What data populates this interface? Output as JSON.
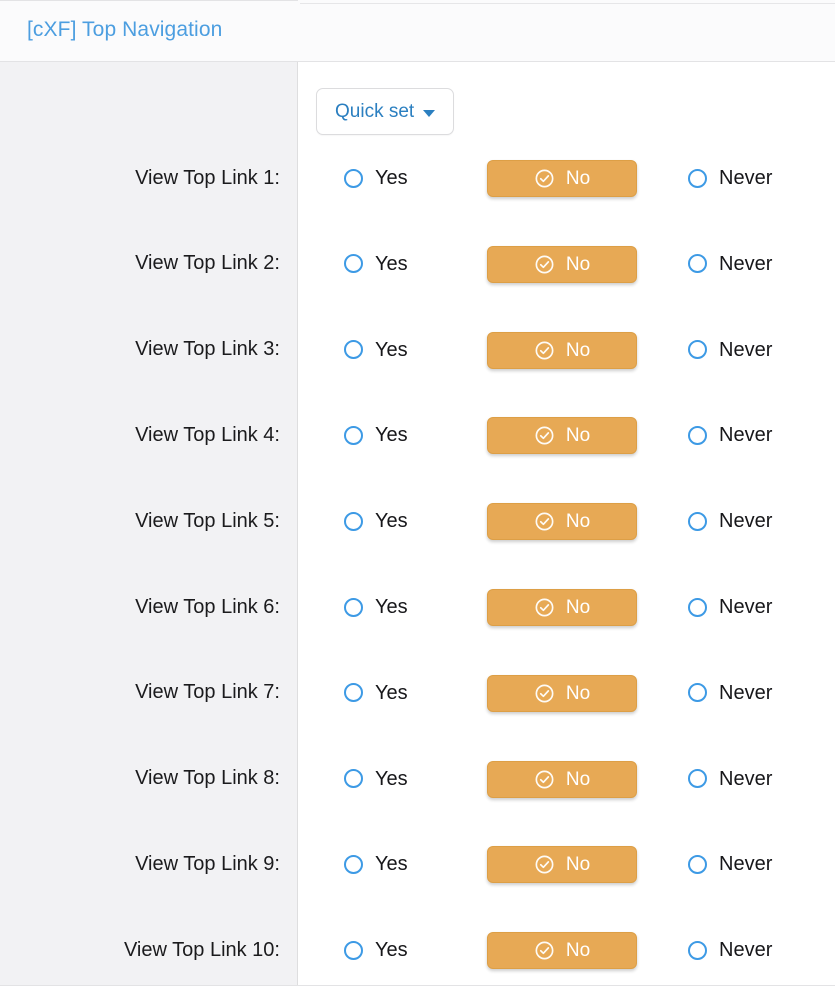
{
  "header": {
    "title": "[cXF] Top Navigation"
  },
  "toolbar": {
    "quick_set_label": "Quick set",
    "caret_icon": "chevron-down-icon"
  },
  "choices": {
    "yes_label": "Yes",
    "no_label": "No",
    "never_label": "Never",
    "selected_icon": "check-circle-icon"
  },
  "colors": {
    "header_title": "#4c9ee0",
    "link_blue": "#2b7fc0",
    "radio_ring": "#3d9ae5",
    "selected_pill_bg": "#e7a955",
    "selected_pill_text": "#ffffff",
    "label_col_bg": "#f2f2f4",
    "value_col_bg": "#ffffff"
  },
  "rows": [
    {
      "label": "View Top Link 1:",
      "value": "No"
    },
    {
      "label": "View Top Link 2:",
      "value": "No"
    },
    {
      "label": "View Top Link 3:",
      "value": "No"
    },
    {
      "label": "View Top Link 4:",
      "value": "No"
    },
    {
      "label": "View Top Link 5:",
      "value": "No"
    },
    {
      "label": "View Top Link 6:",
      "value": "No"
    },
    {
      "label": "View Top Link 7:",
      "value": "No"
    },
    {
      "label": "View Top Link 8:",
      "value": "No"
    },
    {
      "label": "View Top Link 9:",
      "value": "No"
    },
    {
      "label": "View Top Link 10:",
      "value": "No"
    }
  ]
}
